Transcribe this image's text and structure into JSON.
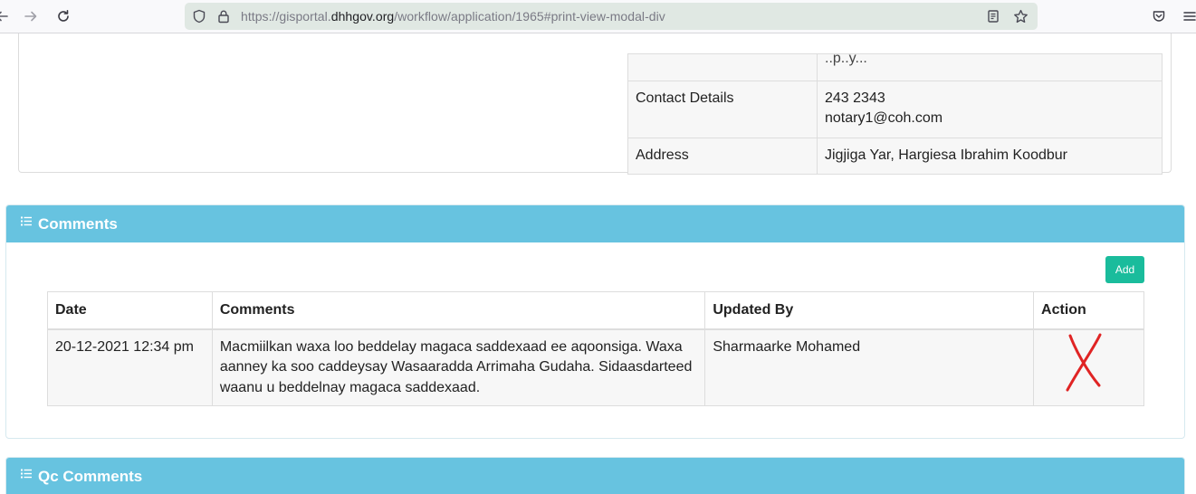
{
  "browser": {
    "url_prefix": "https://gisportal.",
    "url_domain": "dhhgov.org",
    "url_path": "/workflow/application/1965#print-view-modal-div",
    "icons": {
      "back": "back-arrow-icon",
      "forward": "forward-arrow-icon",
      "reload": "reload-icon",
      "shield": "shield-icon",
      "lock": "lock-icon",
      "reader": "reader-view-icon",
      "bookmark": "star-icon",
      "pocket": "pocket-icon",
      "menu": "hamburger-menu-icon"
    }
  },
  "contact_table": {
    "rows": [
      {
        "label": "",
        "value": "..p..y..."
      },
      {
        "label": "Contact Details",
        "value_lines": [
          "243 2343",
          "notary1@coh.com"
        ]
      },
      {
        "label": "Address",
        "value": "Jigjiga Yar, Hargiesa Ibrahim Koodbur"
      }
    ]
  },
  "comments_panel": {
    "title": "Comments",
    "add_label": "Add",
    "headers": {
      "date": "Date",
      "comments": "Comments",
      "updated_by": "Updated By",
      "action": "Action"
    },
    "rows": [
      {
        "date": "20-12-2021 12:34 pm",
        "comment": "Macmiilkan waxa loo beddelay magaca saddexaad ee aqoonsiga. Waxa aanney ka soo caddeysay Wasaaradda Arrimaha Gudaha. Sidaasdarteed waanu u beddelnay magaca saddexaad.",
        "updated_by": "Sharmaarke Mohamed",
        "action_icon": "red-x-delete-icon"
      }
    ]
  },
  "qc_panel": {
    "title": "Qc Comments"
  },
  "colors": {
    "panel_heading": "#67c3e0",
    "add_button": "#1abc9c",
    "delete_mark": "#e02424",
    "url_bar": "#e0e8e3"
  }
}
